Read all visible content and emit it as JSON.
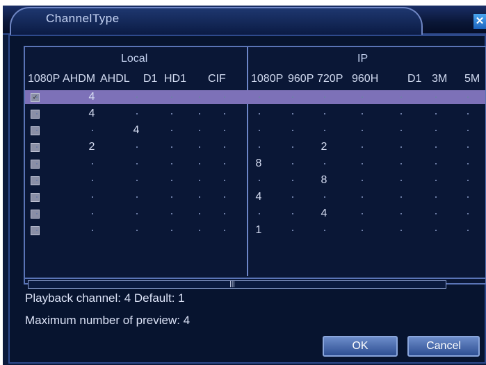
{
  "window": {
    "title": "ChannelType",
    "close_glyph": "✕"
  },
  "sections": {
    "local": "Local",
    "ip": "IP"
  },
  "local_columns": [
    "1080P",
    "AHDM",
    "AHDL",
    "D1",
    "HD1",
    "CIF"
  ],
  "ip_columns": [
    "1080P",
    "960P",
    "720P",
    "960H",
    "D1",
    "3M",
    "5M"
  ],
  "rows": [
    {
      "checked": true,
      "selected": true,
      "check_glyph": "✓",
      "local": [
        "",
        "4",
        "",
        "",
        "",
        ""
      ],
      "ip": [
        "",
        "",
        "",
        "",
        "",
        "",
        ""
      ]
    },
    {
      "checked": false,
      "selected": false,
      "check_glyph": "",
      "local": [
        "",
        "4",
        "",
        "",
        "",
        ""
      ],
      "ip": [
        "",
        "",
        "",
        "",
        "",
        "",
        ""
      ]
    },
    {
      "checked": false,
      "selected": false,
      "check_glyph": "",
      "local": [
        "",
        "",
        "4",
        "",
        "",
        ""
      ],
      "ip": [
        "",
        "",
        "",
        "",
        "",
        "",
        ""
      ]
    },
    {
      "checked": false,
      "selected": false,
      "check_glyph": "",
      "local": [
        "",
        "2",
        "",
        "",
        "",
        ""
      ],
      "ip": [
        "",
        "",
        "2",
        "",
        "",
        "",
        ""
      ]
    },
    {
      "checked": false,
      "selected": false,
      "check_glyph": "",
      "local": [
        "",
        "",
        "",
        "",
        "",
        ""
      ],
      "ip": [
        "8",
        "",
        "",
        "",
        "",
        "",
        ""
      ]
    },
    {
      "checked": false,
      "selected": false,
      "check_glyph": "",
      "local": [
        "",
        "",
        "",
        "",
        "",
        ""
      ],
      "ip": [
        "",
        "",
        "8",
        "",
        "",
        "",
        ""
      ]
    },
    {
      "checked": false,
      "selected": false,
      "check_glyph": "",
      "local": [
        "",
        "",
        "",
        "",
        "",
        ""
      ],
      "ip": [
        "4",
        "",
        "",
        "",
        "",
        "",
        ""
      ]
    },
    {
      "checked": false,
      "selected": false,
      "check_glyph": "",
      "local": [
        "",
        "",
        "",
        "",
        "",
        ""
      ],
      "ip": [
        "",
        "",
        "4",
        "",
        "",
        "",
        ""
      ]
    },
    {
      "checked": false,
      "selected": false,
      "check_glyph": "",
      "local": [
        "",
        "",
        "",
        "",
        "",
        ""
      ],
      "ip": [
        "1",
        "",
        "",
        "",
        "",
        "",
        ""
      ]
    }
  ],
  "scrollbar": {
    "thumb_glyph": "|||"
  },
  "info": {
    "playback": "Playback channel: 4  Default: 1",
    "preview": "Maximum number of preview: 4"
  },
  "buttons": {
    "ok": "OK",
    "cancel": "Cancel"
  },
  "colors": {
    "background": "#0b1a3c",
    "selected_row": "#7d71b8",
    "accent": "#5a74b6"
  }
}
